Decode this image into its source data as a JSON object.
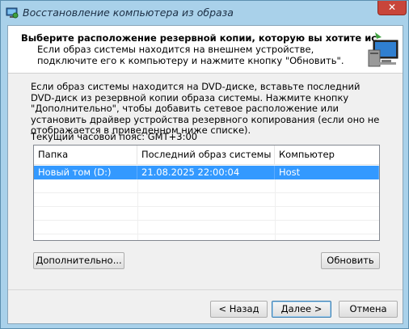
{
  "window": {
    "title": "Восстановление компьютера из образа",
    "close_label": "✕"
  },
  "header": {
    "title": "Выберите расположение резервной копии, которую вы хотите использовать для",
    "description": "Если образ системы находится на внешнем устройстве, подключите его к компьютеру и нажмите кнопку \"Обновить\"."
  },
  "info_text": "Если образ системы находится на DVD-диске, вставьте последний DVD-диск из резервной копии образа системы. Нажмите кнопку \"Дополнительно\", чтобы добавить сетевое расположение или установить драйвер устройства резервного копирования (если оно не отображается в приведенном ниже списке).",
  "timezone_label": "Текущий часовой пояс: GMT+3:00",
  "table": {
    "columns": [
      "Папка",
      "Последний образ системы",
      "Компьютер"
    ],
    "rows": [
      {
        "folder": "Новый том (D:)",
        "last_image": "21.08.2025 22:00:04",
        "computer": "Host"
      }
    ]
  },
  "buttons": {
    "advanced": "Дополнительно...",
    "refresh": "Обновить",
    "back": "< Назад",
    "next": "Далее >",
    "cancel": "Отмена"
  },
  "colors": {
    "selection": "#3399ff",
    "window_frame": "#a9d1ea"
  }
}
